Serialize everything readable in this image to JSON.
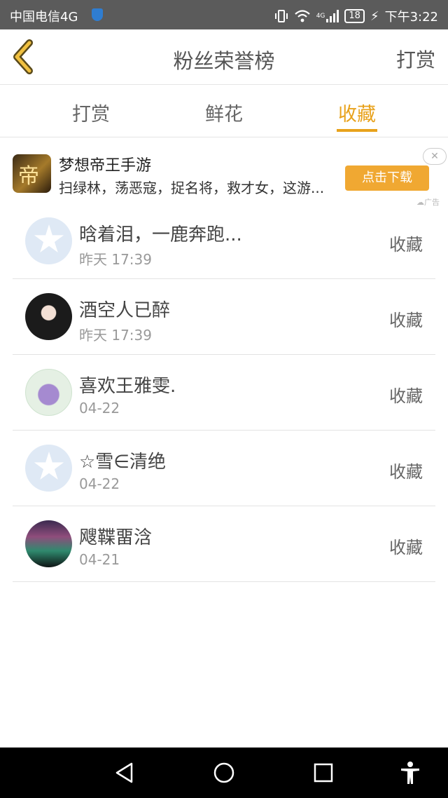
{
  "status_bar": {
    "carrier": "中国电信4G",
    "network_label": "4G",
    "battery": "18",
    "time": "下午3:22"
  },
  "header": {
    "title": "粉丝荣誉榜",
    "right_action": "打赏",
    "accent_color": "#e8a21c"
  },
  "tabs": [
    {
      "label": "打赏",
      "active": false
    },
    {
      "label": "鲜花",
      "active": false
    },
    {
      "label": "收藏",
      "active": true
    }
  ],
  "ad": {
    "icon_text": "帝",
    "title": "梦想帝王手游",
    "description": "扫绿林，荡恶寇，捉名将，救才女，这游...",
    "download_label": "点击下载",
    "close_label": "✕",
    "ad_label": "广告"
  },
  "list": [
    {
      "name": "晗着泪，一鹿奔跑...",
      "time": "昨天 17:39",
      "action": "收藏",
      "avatar": "qq-default-avatar"
    },
    {
      "name": "酒空人已醉",
      "time": "昨天 17:39",
      "action": "收藏",
      "avatar": "girl-portrait-avatar"
    },
    {
      "name": "喜欢王雅雯.",
      "time": "04-22",
      "action": "收藏",
      "avatar": "cup-photo-avatar"
    },
    {
      "name": "☆雪∈清绝",
      "time": "04-22",
      "action": "收藏",
      "avatar": "qq-default-avatar"
    },
    {
      "name": "飕鞢畱浛",
      "time": "04-21",
      "action": "收藏",
      "avatar": "aurora-photo-avatar"
    }
  ],
  "nav_bar": {
    "buttons": [
      "back-triangle-icon",
      "home-circle-icon",
      "recents-square-icon",
      "accessibility-icon"
    ]
  }
}
